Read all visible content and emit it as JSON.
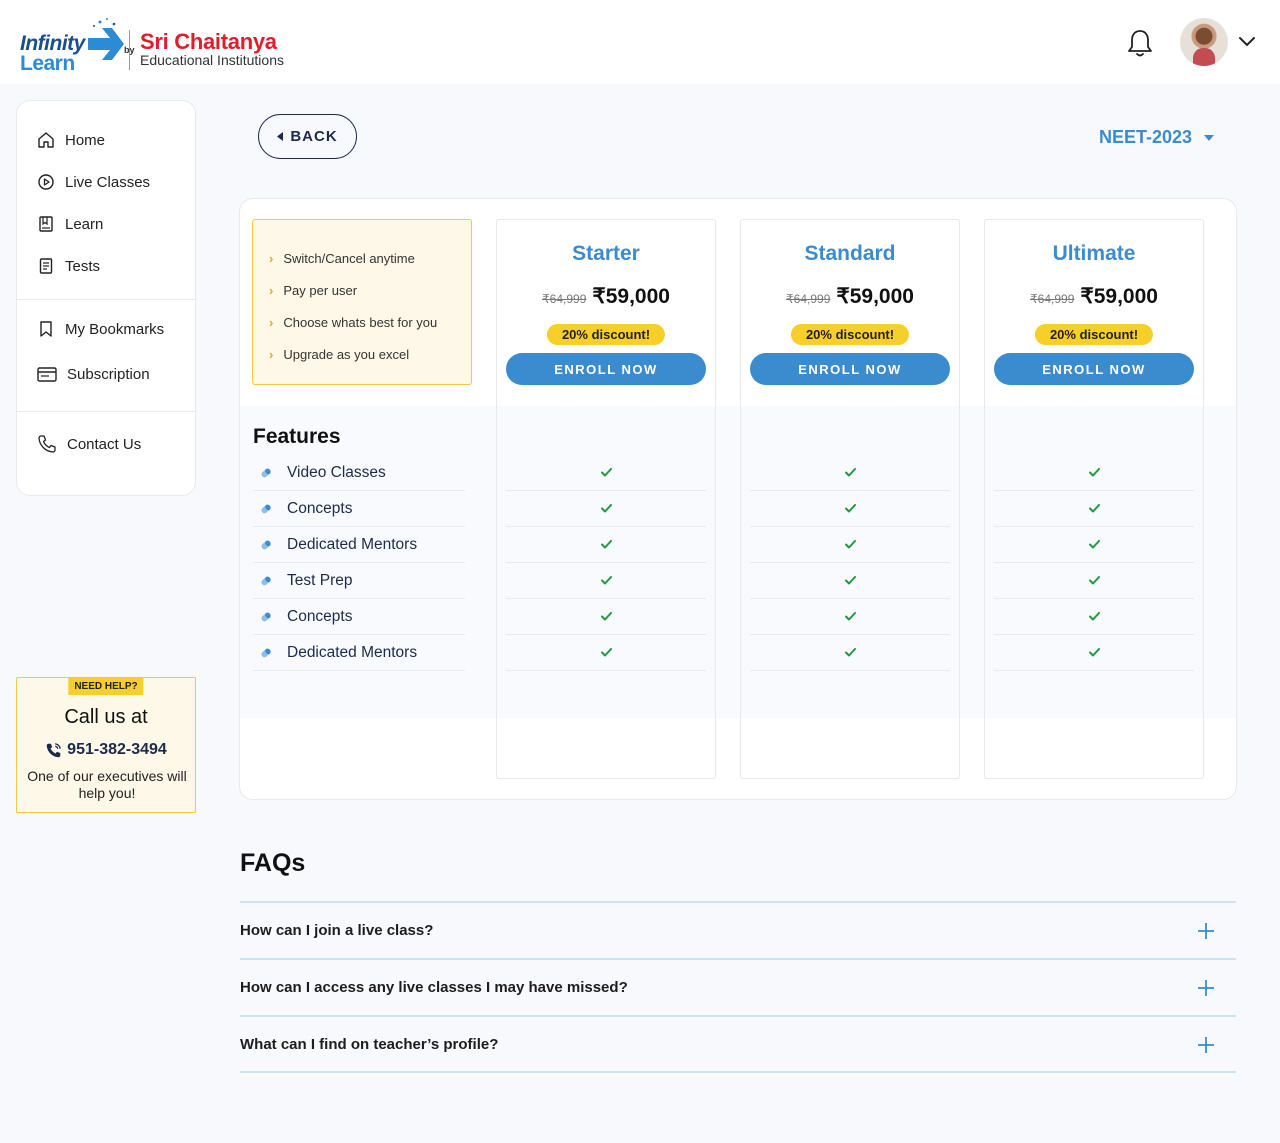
{
  "header": {
    "brand_infinity": "Infinity",
    "brand_learn": "Learn",
    "brand_by": "by",
    "brand_partner": "Sri Chaitanya",
    "brand_partner_sub": "Educational Institutions",
    "icons": [
      "bell-icon",
      "avatar",
      "chevron-down-icon"
    ]
  },
  "sidebar": {
    "items": [
      {
        "label": "Home",
        "icon": "home-icon"
      },
      {
        "label": "Live Classes",
        "icon": "play-circle-icon"
      },
      {
        "label": "Learn",
        "icon": "book-icon"
      },
      {
        "label": "Tests",
        "icon": "document-icon"
      },
      {
        "label": "My Bookmarks",
        "icon": "bookmark-icon"
      },
      {
        "label": "Subscription",
        "icon": "card-icon"
      },
      {
        "label": "Contact Us",
        "icon": "phone-icon"
      }
    ]
  },
  "help": {
    "tag": "NEED HELP?",
    "title": "Call us at",
    "phone": "951-382-3494",
    "desc": "One of our executives will help you!"
  },
  "toolbar": {
    "back_label": "BACK",
    "exam": "NEET-2023"
  },
  "benefits": [
    "Switch/Cancel anytime",
    "Pay per user",
    "Choose whats best for you",
    "Upgrade as you excel"
  ],
  "plans": [
    {
      "name": "Starter",
      "old_price": "₹64,999",
      "price": "₹59,000",
      "discount": "20% discount!",
      "cta": "ENROLL NOW"
    },
    {
      "name": "Standard",
      "old_price": "₹64,999",
      "price": "₹59,000",
      "discount": "20% discount!",
      "cta": "ENROLL NOW"
    },
    {
      "name": "Ultimate",
      "old_price": "₹64,999",
      "price": "₹59,000",
      "discount": "20% discount!",
      "cta": "ENROLL NOW"
    }
  ],
  "features": {
    "title": "Features",
    "items": [
      "Video Classes",
      "Concepts",
      "Dedicated Mentors",
      "Test Prep",
      "Concepts",
      "Dedicated Mentors"
    ],
    "included": [
      [
        true,
        true,
        true
      ],
      [
        true,
        true,
        true
      ],
      [
        true,
        true,
        true
      ],
      [
        true,
        true,
        true
      ],
      [
        true,
        true,
        true
      ],
      [
        true,
        true,
        true
      ]
    ]
  },
  "faq": {
    "title": "FAQs",
    "items": [
      "How can I join a live class?",
      "How can I access any live classes I may have missed?",
      "What can I find on teacher’s profile?"
    ]
  },
  "colors": {
    "accent": "#3a8ccf",
    "highlight": "#f7cf2a",
    "check": "#1a9c3e",
    "brand_red": "#e21d2b"
  }
}
